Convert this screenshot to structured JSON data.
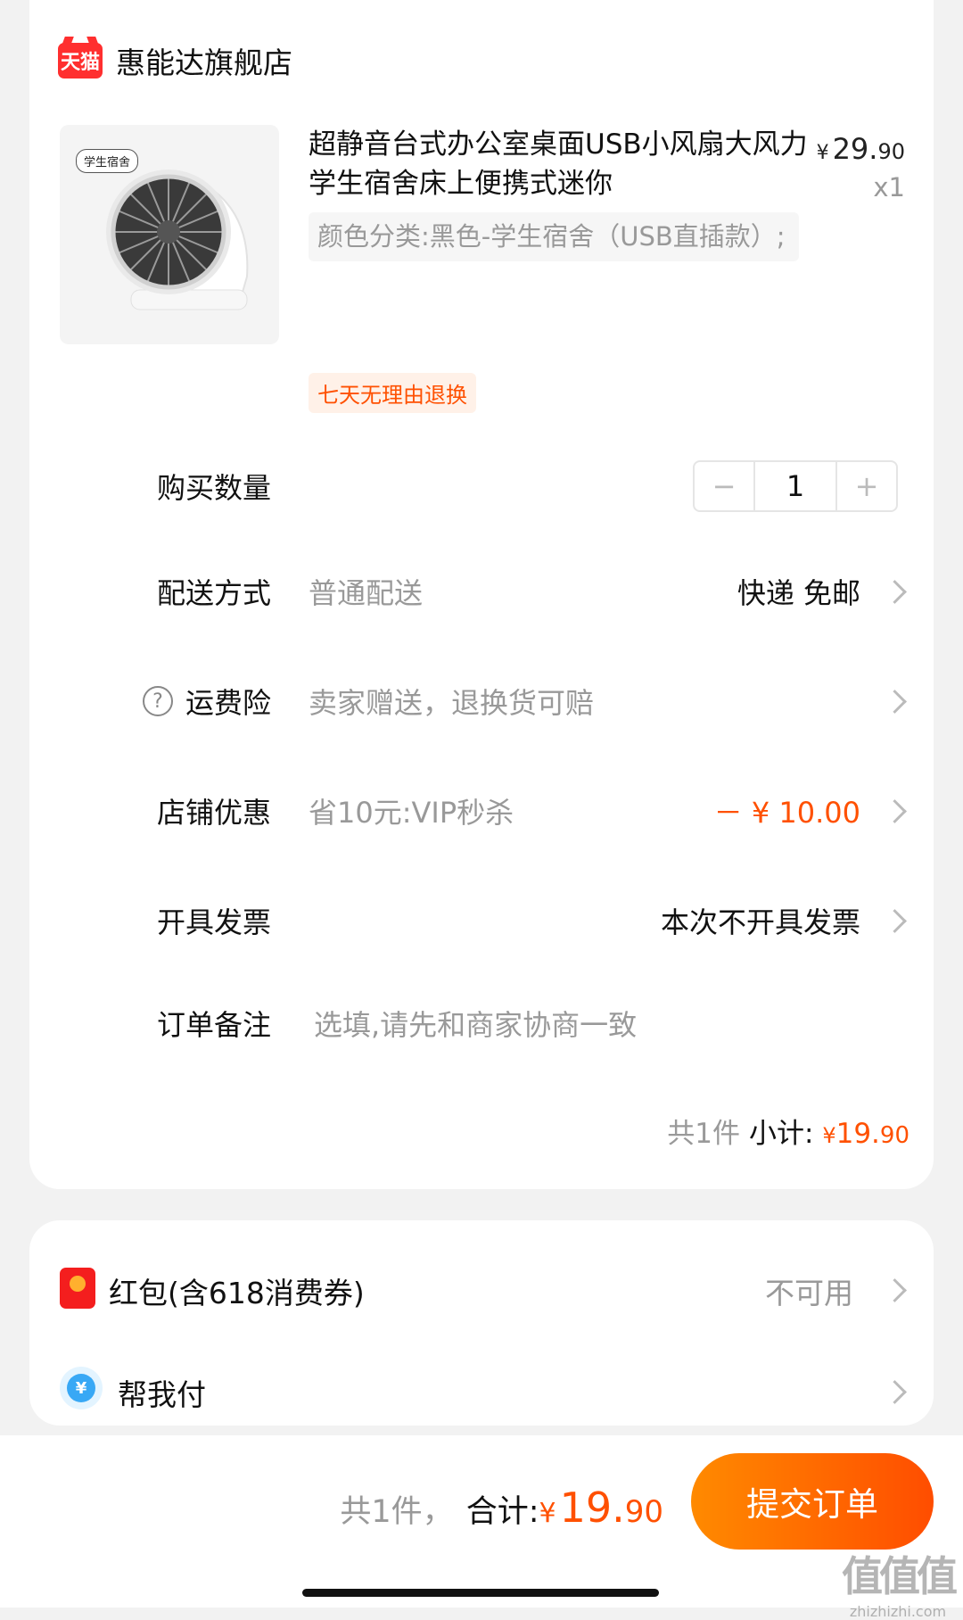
{
  "shop": {
    "platform_badge": "天猫",
    "name": "惠能达旗舰店"
  },
  "product": {
    "image_tag": "学生宿舍",
    "title": "超静音台式办公室桌面USB小风扇大风力学生宿舍床上便携式迷你",
    "price_symbol": "¥",
    "price_int": "29.",
    "price_dec": "90",
    "quantity_label": "x1",
    "sku": "颜色分类:黑色-学生宿舍（USB直插款）;",
    "return_policy": "七天无理由退换"
  },
  "quantity": {
    "label": "购买数量",
    "minus": "−",
    "value": "1",
    "plus": "+"
  },
  "delivery": {
    "label": "配送方式",
    "value": "普通配送",
    "right": "快递 免邮"
  },
  "insurance": {
    "icon_glyph": "?",
    "label": "运费险",
    "value": "卖家赠送，退换货可赔"
  },
  "store_discount": {
    "label": "店铺优惠",
    "value": "省10元:VIP秒杀",
    "right": "－ ¥ 10.00"
  },
  "invoice": {
    "label": "开具发票",
    "right": "本次不开具发票"
  },
  "note": {
    "label": "订单备注",
    "placeholder": "选填,请先和商家协商一致"
  },
  "subtotal": {
    "count_text": "共1件",
    "label": "小计:",
    "symbol": "¥",
    "int": "19.",
    "dec": "90"
  },
  "red_packet": {
    "label": "红包(含618消费券)",
    "status": "不可用"
  },
  "help_pay": {
    "icon_glyph": "¥",
    "label": "帮我付"
  },
  "footer": {
    "count_text": "共1件，",
    "total_label": "合计:",
    "symbol": "¥",
    "int": "19.",
    "dec": "90",
    "submit": "提交订单"
  },
  "watermark": {
    "big": "值值值",
    "small": "zhizhizhi.com"
  },
  "colors": {
    "accent": "#ff5000",
    "submit_gradient_start": "#ff8a00",
    "submit_gradient_end": "#ff4d00",
    "tmall_red": "#ff2f2f"
  }
}
